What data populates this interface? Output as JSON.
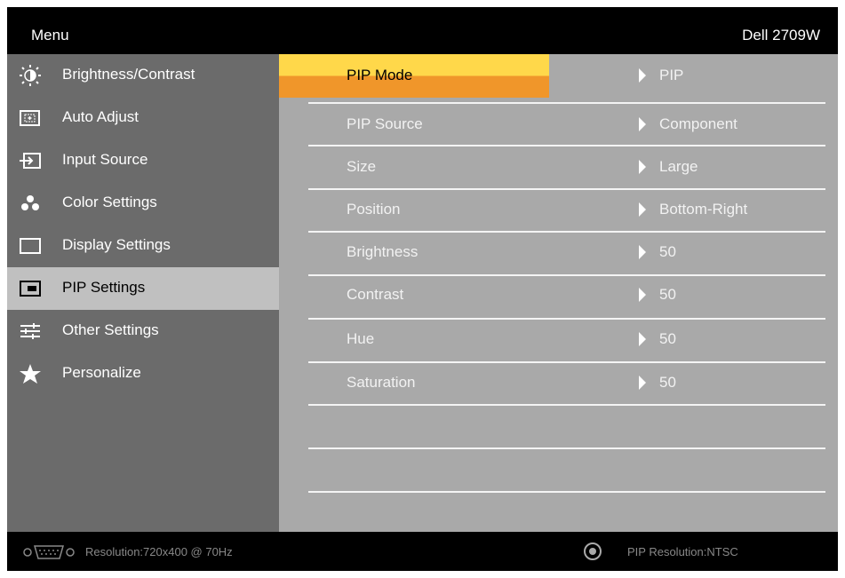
{
  "header": {
    "menu_title": "Menu",
    "model": "Dell 2709W"
  },
  "sidebar": {
    "items": [
      {
        "label": "Brightness/Contrast",
        "icon": "sun-icon"
      },
      {
        "label": "Auto Adjust",
        "icon": "auto-adjust-icon"
      },
      {
        "label": "Input Source",
        "icon": "input-source-icon"
      },
      {
        "label": "Color Settings",
        "icon": "color-dots-icon"
      },
      {
        "label": "Display Settings",
        "icon": "display-rectangle-icon"
      },
      {
        "label": "PIP Settings",
        "icon": "pip-icon",
        "active": true
      },
      {
        "label": "Other Settings",
        "icon": "sliders-icon"
      },
      {
        "label": "Personalize",
        "icon": "star-icon"
      }
    ]
  },
  "main": {
    "rows": [
      {
        "label": "PIP Mode",
        "value": "PIP",
        "selected": true
      },
      {
        "label": "PIP Source",
        "value": "Component"
      },
      {
        "label": "Size",
        "value": "Large"
      },
      {
        "label": "Position",
        "value": "Bottom-Right"
      },
      {
        "label": "Brightness",
        "value": "50"
      },
      {
        "label": "Contrast",
        "value": "50"
      },
      {
        "label": "Hue",
        "value": "50"
      },
      {
        "label": "Saturation",
        "value": "50"
      }
    ]
  },
  "footer": {
    "resolution": "Resolution:720x400 @ 70Hz",
    "pip_resolution": "PIP Resolution:NTSC"
  },
  "colors": {
    "selected_top": "#ffd84a",
    "selected_bottom": "#f0962a",
    "sidebar_bg": "#6b6b6b",
    "main_bg": "#a9a9a9",
    "active_item_bg": "#c0c0c0"
  }
}
